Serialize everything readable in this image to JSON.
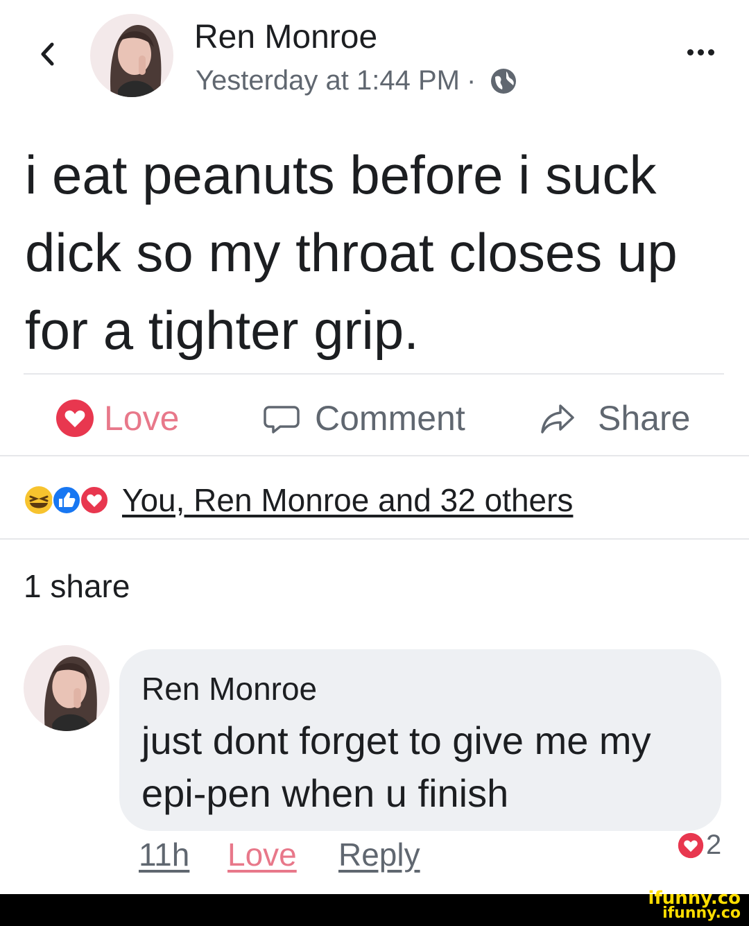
{
  "post": {
    "author": "Ren Monroe",
    "timestamp": "Yesterday at 1:44 PM",
    "separator": "·",
    "audience_icon": "globe-icon",
    "text": "i eat peanuts before i suck dick so my throat closes up for a tighter grip."
  },
  "actions": {
    "love_label": "Love",
    "comment_label": "Comment",
    "share_label": "Share"
  },
  "reactions": {
    "icons": [
      "haha-icon",
      "like-icon",
      "love-icon"
    ],
    "summary": "You, Ren Monroe and 32 others"
  },
  "shares": {
    "count_label": "1 share"
  },
  "comment": {
    "author": "Ren Monroe",
    "text": "just dont forget to give me my epi-pen when u finish",
    "time": "11h",
    "love_label": "Love",
    "reply_label": "Reply",
    "reaction_icon": "love-icon",
    "reaction_count": "2"
  },
  "watermark": {
    "line1": "ifunny.co",
    "line2": "ifunny.co"
  },
  "colors": {
    "love": "#e8374f",
    "like": "#1877f2",
    "haha": "#f7c32e",
    "text_secondary": "#606770",
    "bubble": "#eef0f3"
  }
}
